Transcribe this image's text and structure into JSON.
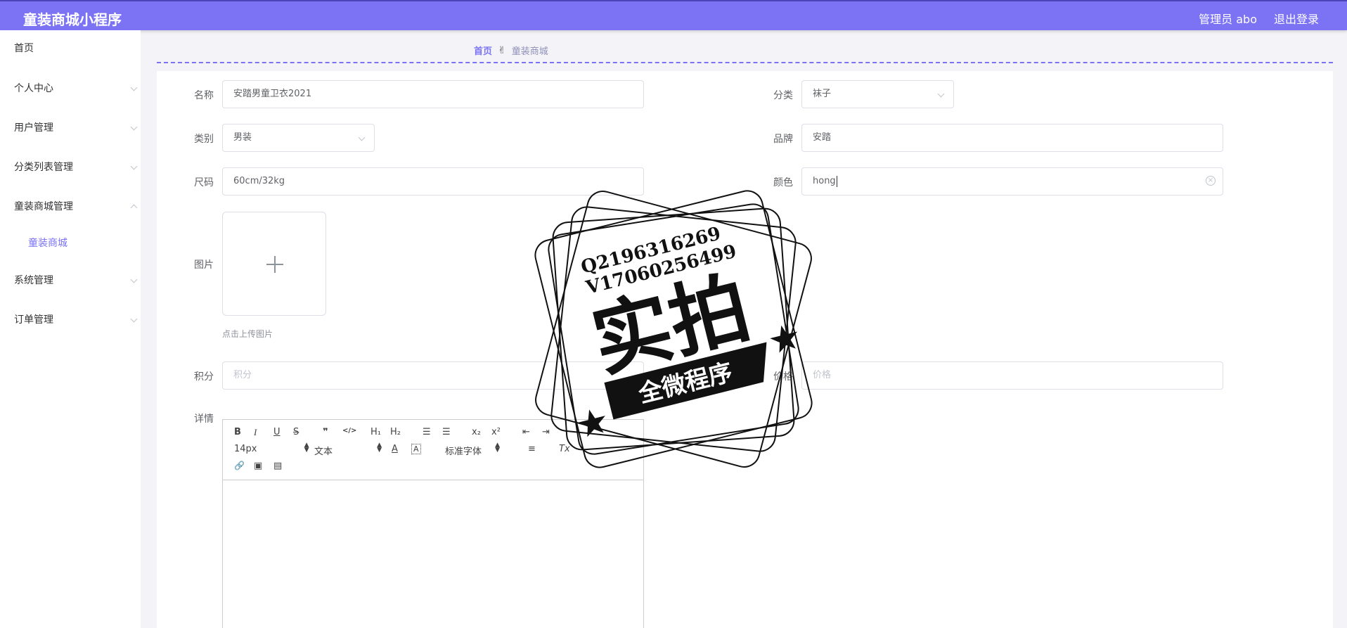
{
  "app": {
    "title": "童装商城小程序"
  },
  "header": {
    "admin_label": "管理员 abo",
    "logout_label": "退出登录"
  },
  "sidebar": {
    "items": [
      {
        "label": "首页"
      },
      {
        "label": "个人中心"
      },
      {
        "label": "用户管理"
      },
      {
        "label": "分类列表管理"
      },
      {
        "label": "童装商城管理",
        "expanded": true,
        "children": [
          {
            "label": "童装商城"
          }
        ]
      },
      {
        "label": "系统管理"
      },
      {
        "label": "订单管理"
      }
    ]
  },
  "breadcrumb": {
    "home": "首页",
    "separator_icon": "hand-icon",
    "current": "童装商城"
  },
  "form": {
    "name": {
      "label": "名称",
      "value": "安踏男童卫衣2021"
    },
    "category": {
      "label": "分类",
      "value": "袜子"
    },
    "type": {
      "label": "类别",
      "value": "男装"
    },
    "brand": {
      "label": "品牌",
      "value": "安踏"
    },
    "size": {
      "label": "尺码",
      "value": "60cm/32kg"
    },
    "color": {
      "label": "颜色",
      "value": "hong"
    },
    "image": {
      "label": "图片",
      "tip": "点击上传图片"
    },
    "points": {
      "label": "积分",
      "placeholder": "积分"
    },
    "price": {
      "label": "价格",
      "placeholder": "价格"
    },
    "detail": {
      "label": "详情"
    }
  },
  "editor": {
    "font_size": "14px",
    "header_select": "文本",
    "font_family": "标准字体",
    "buttons": {
      "bold": "B",
      "italic": "I",
      "underline": "U",
      "strike": "S",
      "quote": "❞",
      "code": "</>",
      "h1": "H₁",
      "h2": "H₂",
      "ordered_list": "☰",
      "bullet_list": "☰",
      "sub": "x₂",
      "sup": "x²",
      "outdent": "⇤",
      "indent": "⇥",
      "color": "A",
      "background": "A",
      "align": "≡",
      "clean": "Tx",
      "link": "🔗",
      "image": "▣",
      "video": "▤"
    }
  },
  "watermark": {
    "line1": "Q2196316269",
    "line2": "V17060256499",
    "main_text": "实拍",
    "banner_text": "全微程序"
  }
}
